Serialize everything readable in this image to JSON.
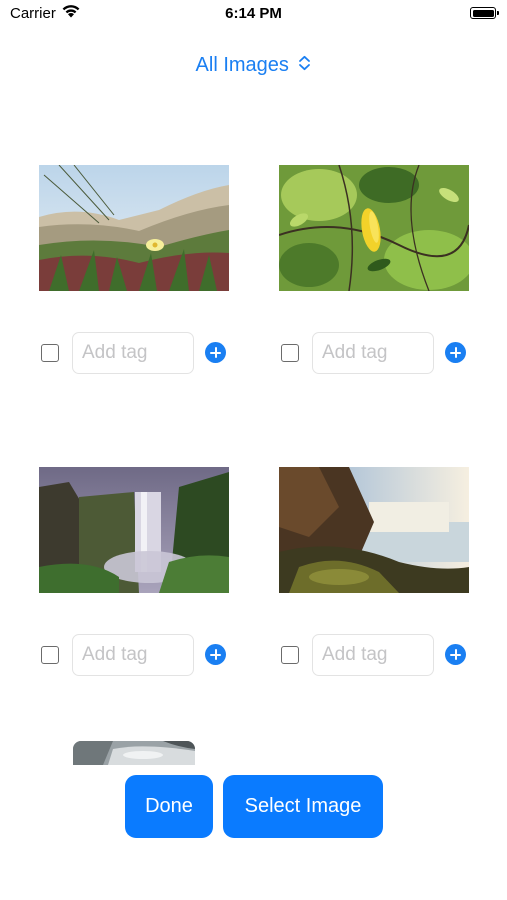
{
  "status_bar": {
    "carrier": "Carrier",
    "time": "6:14 PM"
  },
  "header": {
    "filter_label": "All Images"
  },
  "grid": {
    "items": [
      {
        "image": "beach-dune-flower-photo",
        "tag_placeholder": "Add tag",
        "tag_value": "",
        "selected": false
      },
      {
        "image": "yellow-leaf-branches-photo",
        "tag_placeholder": "Add tag",
        "tag_value": "",
        "selected": false
      },
      {
        "image": "misty-waterfall-photo",
        "tag_placeholder": "Add tag",
        "tag_value": "",
        "selected": false
      },
      {
        "image": "sunlit-waterfall-photo",
        "tag_placeholder": "Add tag",
        "tag_value": "",
        "selected": false
      }
    ],
    "partial_item": {
      "image": "stream-rocks-photo"
    }
  },
  "actions": {
    "done_label": "Done",
    "select_image_label": "Select Image"
  },
  "colors": {
    "accent": "#1a7ff2",
    "button_bg": "#0a7bff",
    "placeholder": "#c4c4c6"
  }
}
